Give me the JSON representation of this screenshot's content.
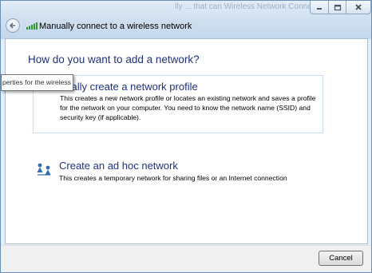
{
  "window": {
    "ghost_title": "lly ... that can  Wireless Network Connection)",
    "title": "Manually connect to a wireless network"
  },
  "main": {
    "heading": "How do you want to add a network?",
    "options": [
      {
        "title": "nually create a network profile",
        "description": "This creates a new network profile or locates an existing network and saves a profile for the network on your computer. You need to know the network name (SSID) and security key (if applicable)."
      },
      {
        "title": "Create an ad hoc network",
        "description": "This creates a temporary network for sharing files or an Internet connection"
      }
    ]
  },
  "tooltip": {
    "text": "perties for the wireless"
  },
  "footer": {
    "cancel_label": "Cancel"
  },
  "icons": {
    "back": "back-arrow-icon",
    "title": "wireless-signal-icon",
    "adhoc": "adhoc-network-icon",
    "minimize": "minimize-icon",
    "maximize": "maximize-icon",
    "close": "close-icon"
  },
  "colors": {
    "heading": "#1e3287",
    "title_bar": "#cfdfef",
    "close_glyph": "#4a4a4a"
  }
}
